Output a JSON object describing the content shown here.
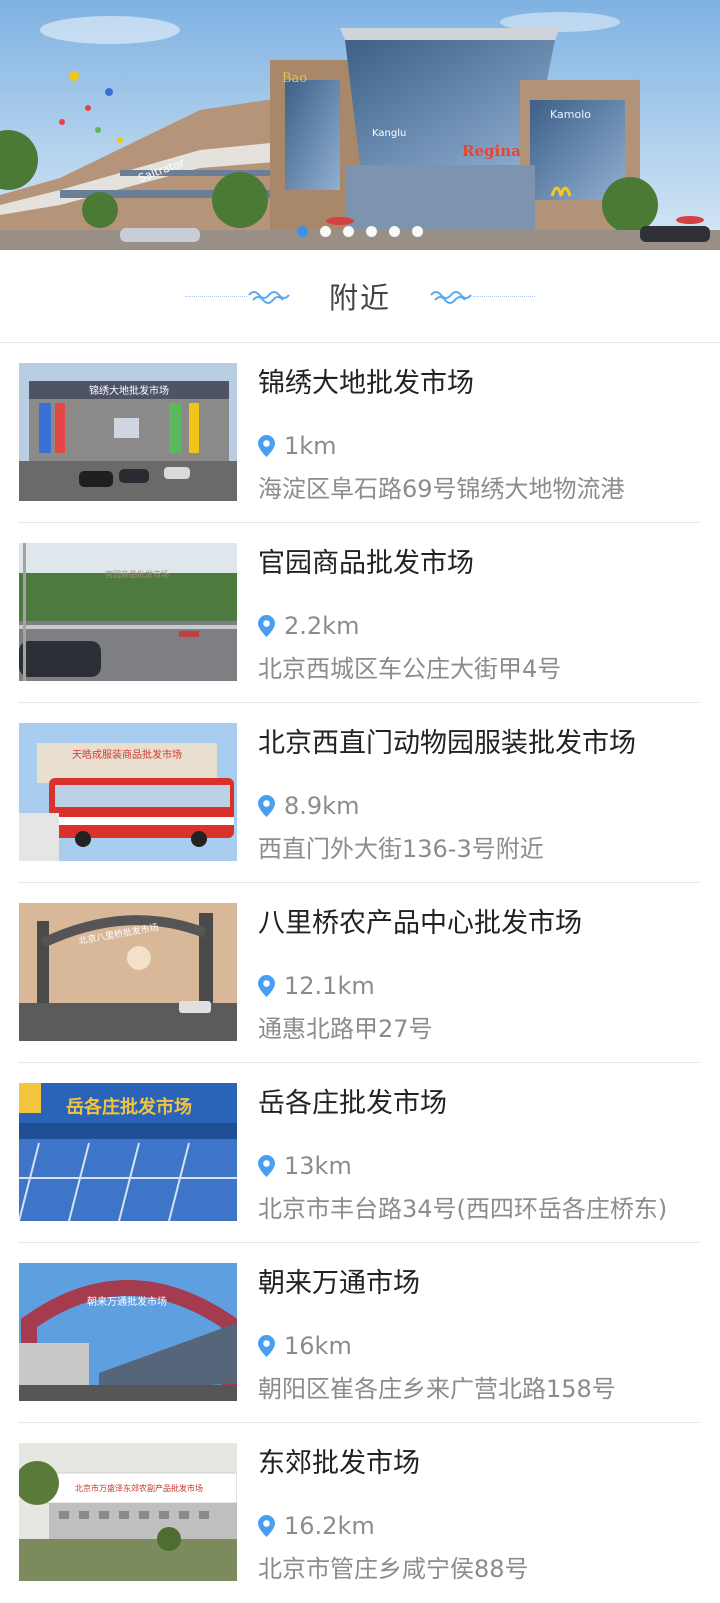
{
  "banner": {
    "signs": [
      "Bao",
      "Saltrator",
      "Kanglu",
      "Kamolo",
      "Regina"
    ],
    "carousel_dots": 6,
    "active_dot": 0
  },
  "section": {
    "title": "附近"
  },
  "colors": {
    "accent": "#3d8fe8",
    "pin": "#4a9ef0",
    "deco": "#5aa8ee",
    "divider": "#e6e6e6",
    "text_primary": "#222222",
    "text_secondary": "#8c8c8c"
  },
  "markets": [
    {
      "name": "锦绣大地批发市场",
      "distance": "1km",
      "address": "海淀区阜石路69号锦绣大地物流港",
      "image_sign": "锦绣大地批发市场"
    },
    {
      "name": "官园商品批发市场",
      "distance": "2.2km",
      "address": "北京西城区车公庄大街甲4号",
      "image_sign": "官园商品批发市场"
    },
    {
      "name": "北京西直门动物园服装批发市场",
      "distance": "8.9km",
      "address": "西直门外大街136-3号附近",
      "image_sign": "天皓成服装商品批发市场"
    },
    {
      "name": "八里桥农产品中心批发市场",
      "distance": "12.1km",
      "address": "通惠北路甲27号",
      "image_sign": "北京八里桥批发市场"
    },
    {
      "name": "岳各庄批发市场",
      "distance": "13km",
      "address": "北京市丰台路34号(西四环岳各庄桥东)",
      "image_sign": "岳各庄批发市场"
    },
    {
      "name": "朝来万通市场",
      "distance": "16km",
      "address": "朝阳区崔各庄乡来广营北路158号",
      "image_sign": "朝来万通批发市场"
    },
    {
      "name": "东郊批发市场",
      "distance": "16.2km",
      "address": "北京市管庄乡咸宁侯88号",
      "image_sign": "北京市万盛泽东郊农副产品批发市场"
    }
  ]
}
